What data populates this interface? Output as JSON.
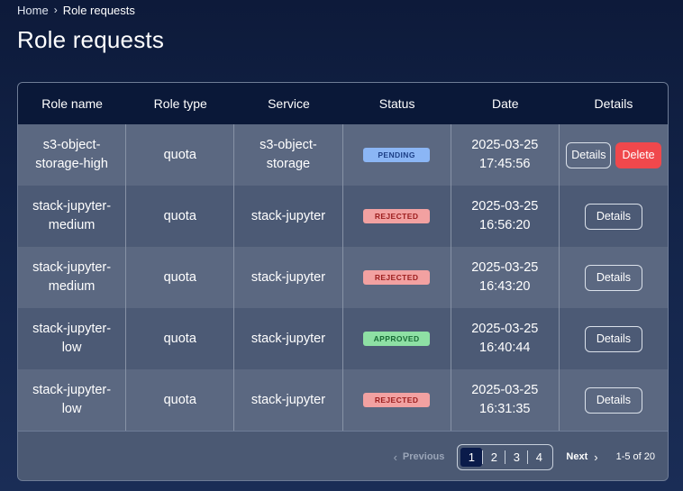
{
  "breadcrumb": {
    "home": "Home",
    "current": "Role requests"
  },
  "page_title": "Role requests",
  "table": {
    "headers": [
      "Role name",
      "Role type",
      "Service",
      "Status",
      "Date",
      "Details"
    ],
    "rows": [
      {
        "role_name": "s3-object-\nstorage-high",
        "role_type": "quota",
        "service": "s3-object-\nstorage",
        "status": "PENDING",
        "date": "2025-03-25\n17:45:56",
        "details_label": "Details",
        "delete_label": "Delete"
      },
      {
        "role_name": "stack-jupyter-\nmedium",
        "role_type": "quota",
        "service": "stack-jupyter",
        "status": "REJECTED",
        "date": "2025-03-25\n16:56:20",
        "details_label": "Details"
      },
      {
        "role_name": "stack-jupyter-\nmedium",
        "role_type": "quota",
        "service": "stack-jupyter",
        "status": "REJECTED",
        "date": "2025-03-25\n16:43:20",
        "details_label": "Details"
      },
      {
        "role_name": "stack-jupyter-\nlow",
        "role_type": "quota",
        "service": "stack-jupyter",
        "status": "APPROVED",
        "date": "2025-03-25\n16:40:44",
        "details_label": "Details"
      },
      {
        "role_name": "stack-jupyter-\nlow",
        "role_type": "quota",
        "service": "stack-jupyter",
        "status": "REJECTED",
        "date": "2025-03-25\n16:31:35",
        "details_label": "Details"
      }
    ]
  },
  "pagination": {
    "previous_label": "Previous",
    "next_label": "Next",
    "pages": [
      "1",
      "2",
      "3",
      "4"
    ],
    "active_page": "1",
    "range": "1-5 of 20"
  },
  "icons": {
    "breadcrumb_sep": "chevron-right-icon",
    "prev": "chevron-left-icon",
    "next": "chevron-right-icon"
  },
  "colors": {
    "pending": "#8bb6f5",
    "rejected": "#f2a1a1",
    "approved": "#8ee0a4",
    "delete": "#f0484c",
    "header": "#0a1838"
  }
}
